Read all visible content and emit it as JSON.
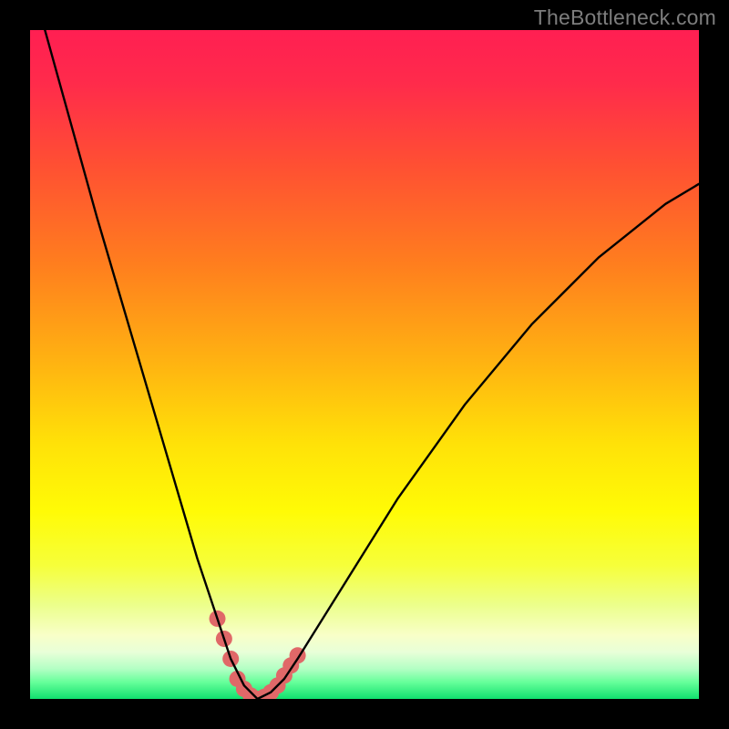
{
  "watermark": "TheBottleneck.com",
  "colors": {
    "frame": "#000000",
    "gradient_stops": [
      {
        "offset": 0.0,
        "color": "#ff1f52"
      },
      {
        "offset": 0.08,
        "color": "#ff2b4b"
      },
      {
        "offset": 0.2,
        "color": "#ff4f33"
      },
      {
        "offset": 0.35,
        "color": "#ff7e1e"
      },
      {
        "offset": 0.5,
        "color": "#ffb411"
      },
      {
        "offset": 0.62,
        "color": "#ffe208"
      },
      {
        "offset": 0.72,
        "color": "#fffb06"
      },
      {
        "offset": 0.8,
        "color": "#f6ff3a"
      },
      {
        "offset": 0.86,
        "color": "#ecff8c"
      },
      {
        "offset": 0.905,
        "color": "#f8ffc8"
      },
      {
        "offset": 0.93,
        "color": "#e8ffd8"
      },
      {
        "offset": 0.955,
        "color": "#b3ffc4"
      },
      {
        "offset": 0.975,
        "color": "#66ff9a"
      },
      {
        "offset": 1.0,
        "color": "#11e06e"
      }
    ],
    "marker": "#e06868",
    "line": "#000000"
  },
  "chart_data": {
    "type": "line",
    "title": "",
    "xlabel": "",
    "ylabel": "",
    "xlim": [
      0,
      100
    ],
    "ylim": [
      0,
      100
    ],
    "notes": "V-shaped bottleneck curve. y-axis inverted visually (0 at bottom = best). Minimum near x≈34. Values are estimated from pixel positions; chart has no numeric tick labels.",
    "x": [
      0,
      5,
      10,
      15,
      20,
      25,
      28,
      30,
      32,
      34,
      36,
      38,
      40,
      45,
      50,
      55,
      60,
      65,
      70,
      75,
      80,
      85,
      90,
      95,
      100
    ],
    "y": [
      108,
      90,
      72,
      55,
      38,
      21,
      12,
      6,
      2,
      0,
      1,
      3,
      6,
      14,
      22,
      30,
      37,
      44,
      50,
      56,
      61,
      66,
      70,
      74,
      77
    ],
    "marker_points": [
      {
        "x": 28,
        "y": 12
      },
      {
        "x": 29,
        "y": 9
      },
      {
        "x": 30,
        "y": 6
      },
      {
        "x": 31,
        "y": 3
      },
      {
        "x": 32,
        "y": 1.5
      },
      {
        "x": 33,
        "y": 0.5
      },
      {
        "x": 34,
        "y": 0
      },
      {
        "x": 35,
        "y": 0.3
      },
      {
        "x": 36,
        "y": 1
      },
      {
        "x": 37,
        "y": 2
      },
      {
        "x": 38,
        "y": 3.5
      },
      {
        "x": 39,
        "y": 5
      },
      {
        "x": 40,
        "y": 6.5
      }
    ]
  }
}
